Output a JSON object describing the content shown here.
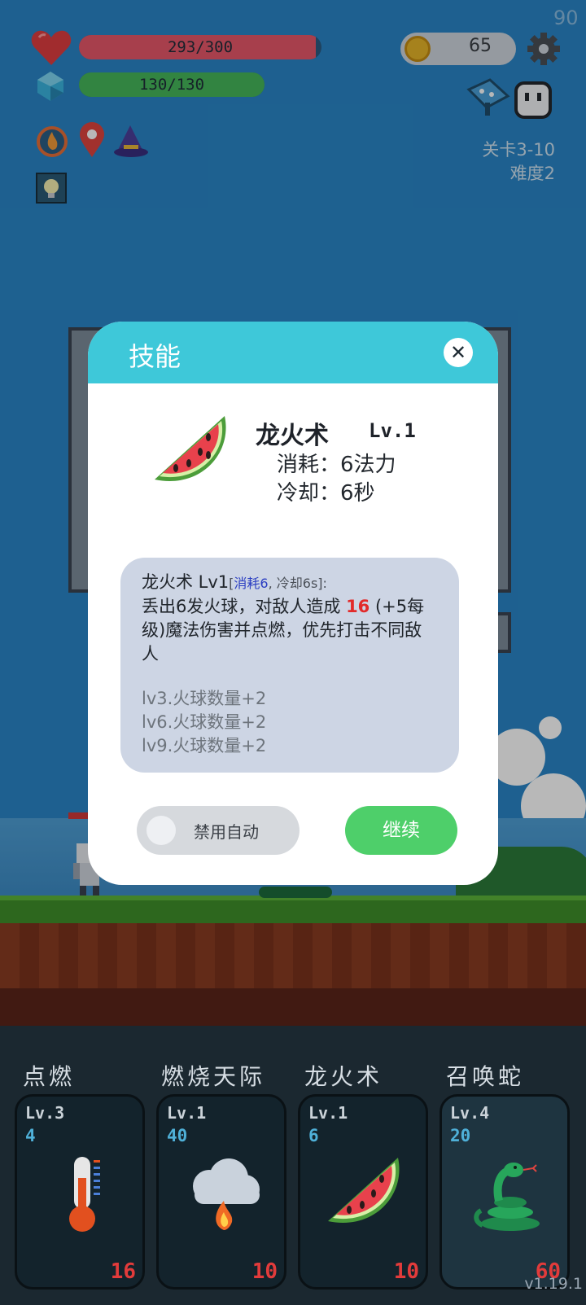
{
  "hud": {
    "fps": "90",
    "hp_text": "293/300",
    "hp_fraction": 0.977,
    "mp_text": "130/130",
    "mp_fraction": 1.0,
    "coins": "65",
    "stage": "关卡3-10",
    "difficulty": "难度2"
  },
  "modal": {
    "title": "技能",
    "close_symbol": "✕",
    "skill_name": "龙火术",
    "skill_level": "Lv.1",
    "cost_line": "消耗：6法力",
    "cooldown_line": "冷却：6秒",
    "desc_name": "龙火术 Lv1",
    "desc_meta_open": "[",
    "desc_meta_cost": "消耗6",
    "desc_meta_rest": ", 冷却6s]:",
    "desc_text_1": "丢出6发火球，对敌人造成",
    "desc_damage": "16",
    "desc_text_2": "(+5每级)魔法伤害并点燃，优先打击不同敌人",
    "bonuses": [
      "lv3.火球数量+2",
      "lv6.火球数量+2",
      "lv9.火球数量+2"
    ],
    "toggle_label": "禁用自动",
    "continue_label": "继续"
  },
  "skills": [
    {
      "title": "点燃",
      "level": "Lv.3",
      "cost": "4",
      "count": "16",
      "icon": "thermometer-icon"
    },
    {
      "title": "燃烧天际",
      "level": "Lv.1",
      "cost": "40",
      "count": "10",
      "icon": "fire-cloud-icon"
    },
    {
      "title": "龙火术",
      "level": "Lv.1",
      "cost": "6",
      "count": "10",
      "icon": "watermelon-icon"
    },
    {
      "title": "召唤蛇",
      "level": "Lv.4",
      "cost": "20",
      "count": "60",
      "icon": "snake-icon"
    }
  ],
  "version": "v1.19.1",
  "colors": {
    "hp": "#e8586a",
    "mp": "#46b85a",
    "modal_header": "#3ec8d9",
    "continue": "#4ecf6a",
    "damage": "#e22a2a"
  }
}
